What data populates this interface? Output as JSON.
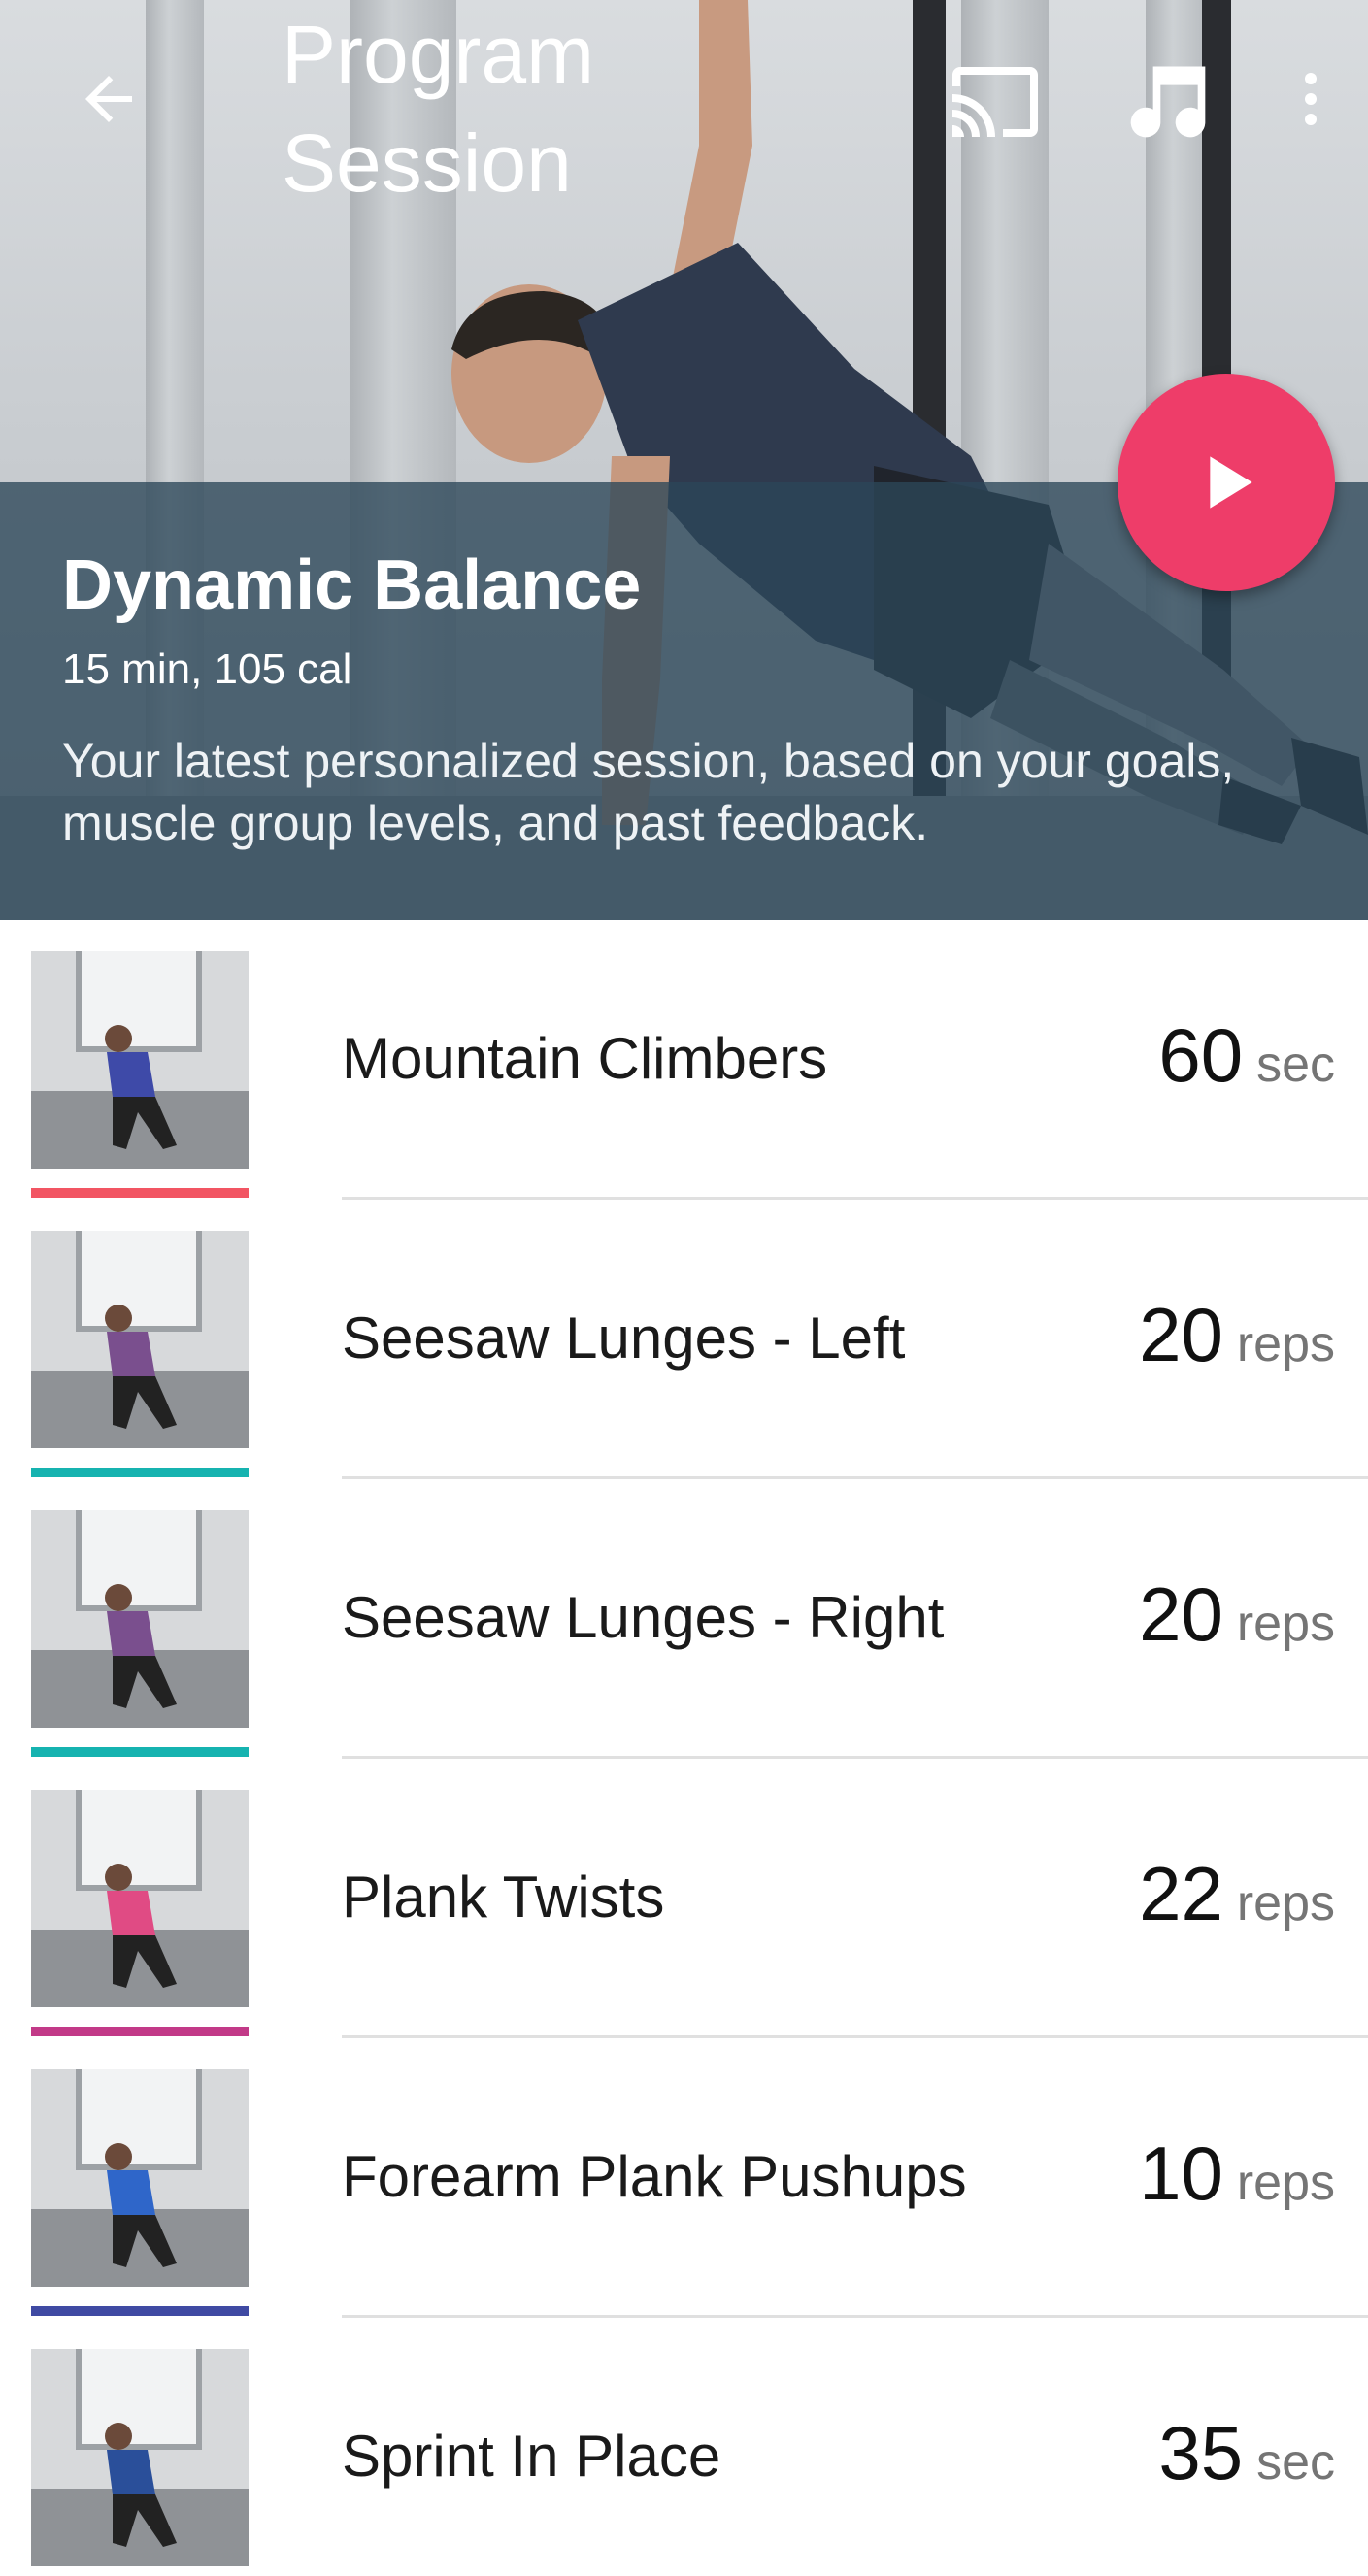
{
  "app_bar": {
    "title": "Program Session",
    "back_icon": "arrow-back-icon",
    "cast_icon": "cast-icon",
    "music_icon": "music-note-icon",
    "more_icon": "more-vert-icon"
  },
  "session": {
    "name": "Dynamic Balance",
    "meta": "15 min, 105 cal",
    "description": "Your latest personalized session, based on your goals, muscle group levels, and past feedback.",
    "play_icon": "play-icon"
  },
  "colors": {
    "accent_play": "#ee3d69",
    "band": "#2c4658"
  },
  "exercises": [
    {
      "name": "Mountain Climbers",
      "value": "60",
      "unit": "sec",
      "bar_color": "#f25563",
      "shirt_color": "#3e4aa8"
    },
    {
      "name": "Seesaw Lunges - Left",
      "value": "20",
      "unit": "reps",
      "bar_color": "#16b3b0",
      "shirt_color": "#7a4f8e"
    },
    {
      "name": "Seesaw Lunges - Right",
      "value": "20",
      "unit": "reps",
      "bar_color": "#16b3b0",
      "shirt_color": "#7a4f8e"
    },
    {
      "name": "Plank Twists",
      "value": "22",
      "unit": "reps",
      "bar_color": "#c23a88",
      "shirt_color": "#e04b84"
    },
    {
      "name": "Forearm Plank Pushups",
      "value": "10",
      "unit": "reps",
      "bar_color": "#3f4aa3",
      "shirt_color": "#2f66c9"
    },
    {
      "name": "Sprint In Place",
      "value": "35",
      "unit": "sec",
      "bar_color": "#3f4aa3",
      "shirt_color": "#2a4f9a"
    }
  ]
}
